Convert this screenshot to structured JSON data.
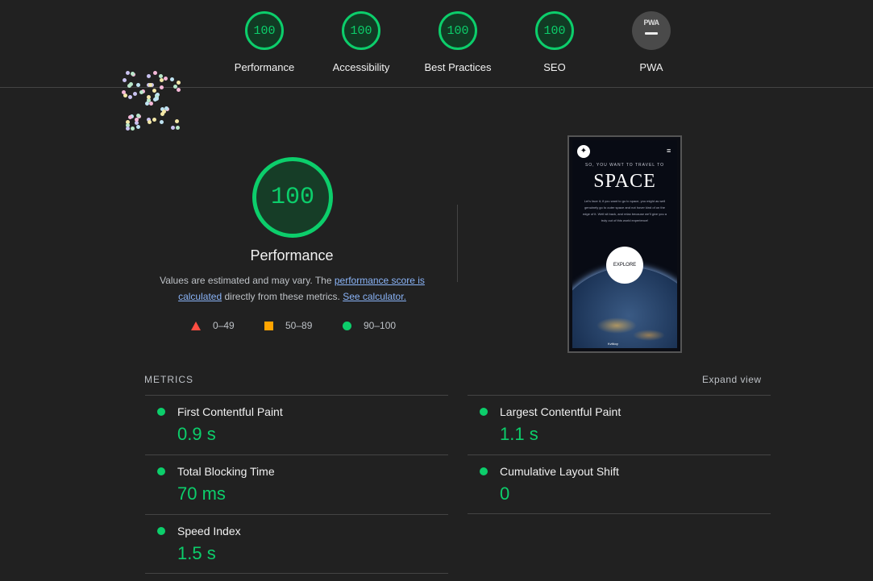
{
  "header": {
    "gauges": [
      {
        "label": "Performance",
        "score": "100"
      },
      {
        "label": "Accessibility",
        "score": "100"
      },
      {
        "label": "Best Practices",
        "score": "100"
      },
      {
        "label": "SEO",
        "score": "100"
      },
      {
        "label": "PWA",
        "badge": "PWA"
      }
    ]
  },
  "summary": {
    "score": "100",
    "title": "Performance",
    "desc_pre": "Values are estimated and may vary. The ",
    "desc_link1": "performance score is calculated",
    "desc_mid": " directly from these metrics. ",
    "desc_link2": "See calculator.",
    "legend": [
      {
        "range": "0–49",
        "color": "#ff4e42"
      },
      {
        "range": "50–89",
        "color": "#ffa400"
      },
      {
        "range": "90–100",
        "color": "#0cce6b"
      }
    ]
  },
  "screenshot": {
    "kicker": "SO, YOU WANT TO TRAVEL TO",
    "heading": "SPACE",
    "paragraph": "Let's face it; if you want to go to space, you might as well genuinely go to outer space and not hover kind of on the edge of it. Well sit back, and relax because we'll give you a truly out of this world experience!",
    "button": "EXPLORE",
    "credit": "Kvitkoy"
  },
  "metrics": {
    "title": "METRICS",
    "expand": "Expand view",
    "items": [
      {
        "label": "First Contentful Paint",
        "value": "0.9 s"
      },
      {
        "label": "Largest Contentful Paint",
        "value": "1.1 s"
      },
      {
        "label": "Total Blocking Time",
        "value": "70 ms"
      },
      {
        "label": "Cumulative Layout Shift",
        "value": "0"
      },
      {
        "label": "Speed Index",
        "value": "1.5 s"
      }
    ]
  },
  "colors": {
    "pass": "#0cce6b",
    "average": "#ffa400",
    "fail": "#ff4e42",
    "link": "#8ab4f8"
  }
}
